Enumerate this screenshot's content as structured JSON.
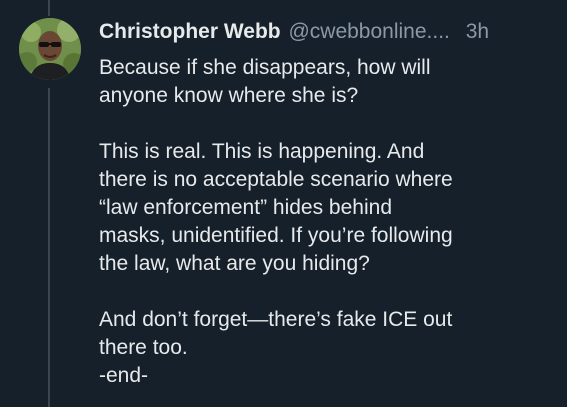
{
  "post": {
    "author_name": "Christopher Webb",
    "handle": "@cwebbonline....",
    "time": "3h",
    "avatar_icon": "profile-photo",
    "paragraphs": [
      "Because if she disappears, how will\nanyone know where she is?",
      "This is real. This is happening. And\nthere is no acceptable scenario where\n“law enforcement” hides behind\nmasks, unidentified. If you’re following\nthe law, what are you hiding?",
      "And don’t forget—there’s fake ICE out\nthere too.\n-end-"
    ]
  },
  "colors": {
    "background": "#15202b",
    "text": "#e7e9ea",
    "muted": "#8b98a5",
    "thread_line": "#3a4550"
  }
}
